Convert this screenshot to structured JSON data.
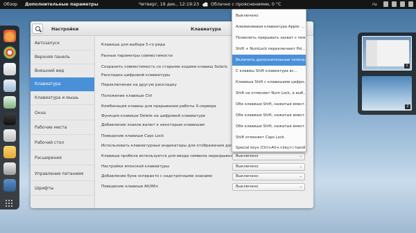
{
  "topbar": {
    "overview": "Обзор",
    "app_name": "Дополнительные параметры",
    "clock": "Четверг, 19 дек., 12:19:23",
    "weather": "Облачно с прояснениями, 0 °C",
    "lang": "ru"
  },
  "window": {
    "sidebar_title": "Настройки",
    "main_title": "Клавиатура"
  },
  "sidebar": {
    "items": [
      {
        "label": "Автозапуск"
      },
      {
        "label": "Верхняя панель"
      },
      {
        "label": "Внешний вид"
      },
      {
        "label": "Клавиатура"
      },
      {
        "label": "Клавиатура и мышь"
      },
      {
        "label": "Окна"
      },
      {
        "label": "Рабочие места"
      },
      {
        "label": "Рабочий стол"
      },
      {
        "label": "Расширения"
      },
      {
        "label": "Управление питанием"
      },
      {
        "label": "Шрифты"
      }
    ]
  },
  "settings": {
    "rows": [
      {
        "label": "Клавиша для выбора 5-го ряда"
      },
      {
        "label": "Разные параметры совместимости"
      },
      {
        "label": "Сохранить совместимость со старыми ходами клавиш Solaris"
      },
      {
        "label": "Раскладка цифровой клавиатуры"
      },
      {
        "label": "Переключение на другую раскладку"
      },
      {
        "label": "Положение клавиши Ctrl"
      },
      {
        "label": "Комбинация клавиш для прерывания работы X-сервера"
      },
      {
        "label": "Функция клавиши Delete на цифровой клавиатуре"
      },
      {
        "label": "Добавление знаков валют к некоторым клавишам"
      },
      {
        "label": "Поведение клавиши Caps Lock"
      },
      {
        "label": "Использовать клавиатурные индикаторы для отображения дополн..."
      },
      {
        "label": "Клавиша пробела используется для ввода символа неразрывного п...",
        "value": "Выключено"
      },
      {
        "label": "Настройки японской клавиатуры",
        "value": "Выключено"
      },
      {
        "label": "Добавление букв эсперанто с надстрочными знаками",
        "value": "Выключено"
      },
      {
        "label": "Поведение клавиши Alt/Win",
        "value": "Выключено"
      }
    ]
  },
  "dropdown": {
    "options": [
      {
        "label": "Выключено"
      },
      {
        "label": "Алюминиевая клавиатура Apple: ..."
      },
      {
        "label": "Позволить прерывать захват с пом..."
      },
      {
        "label": "Shift + NumLock переключают Poi..."
      },
      {
        "label": "Включить дополнительные типогр...",
        "selected": true
      },
      {
        "label": "С клавиш Shift клавиатура вс..."
      },
      {
        "label": "Клавиша Shift с клавишами цифро..."
      },
      {
        "label": "Shift не отменяет Num Lock, а выб..."
      },
      {
        "label": "Обе клавиши Shift, нажатые вмест..."
      },
      {
        "label": "Обе клавиши Shift, нажатые вмест..."
      },
      {
        "label": "Обе клавиши Shift, нажатые вмест..."
      },
      {
        "label": "Shift отменяет Caps Lock"
      },
      {
        "label": "Special keys (Ctrl+Alt+<key>) handl..."
      }
    ]
  },
  "workspaces": [
    {
      "number": "1"
    },
    {
      "number": "2"
    }
  ],
  "colors": {
    "accent": "#4a90d9",
    "topbar": "#151515"
  }
}
